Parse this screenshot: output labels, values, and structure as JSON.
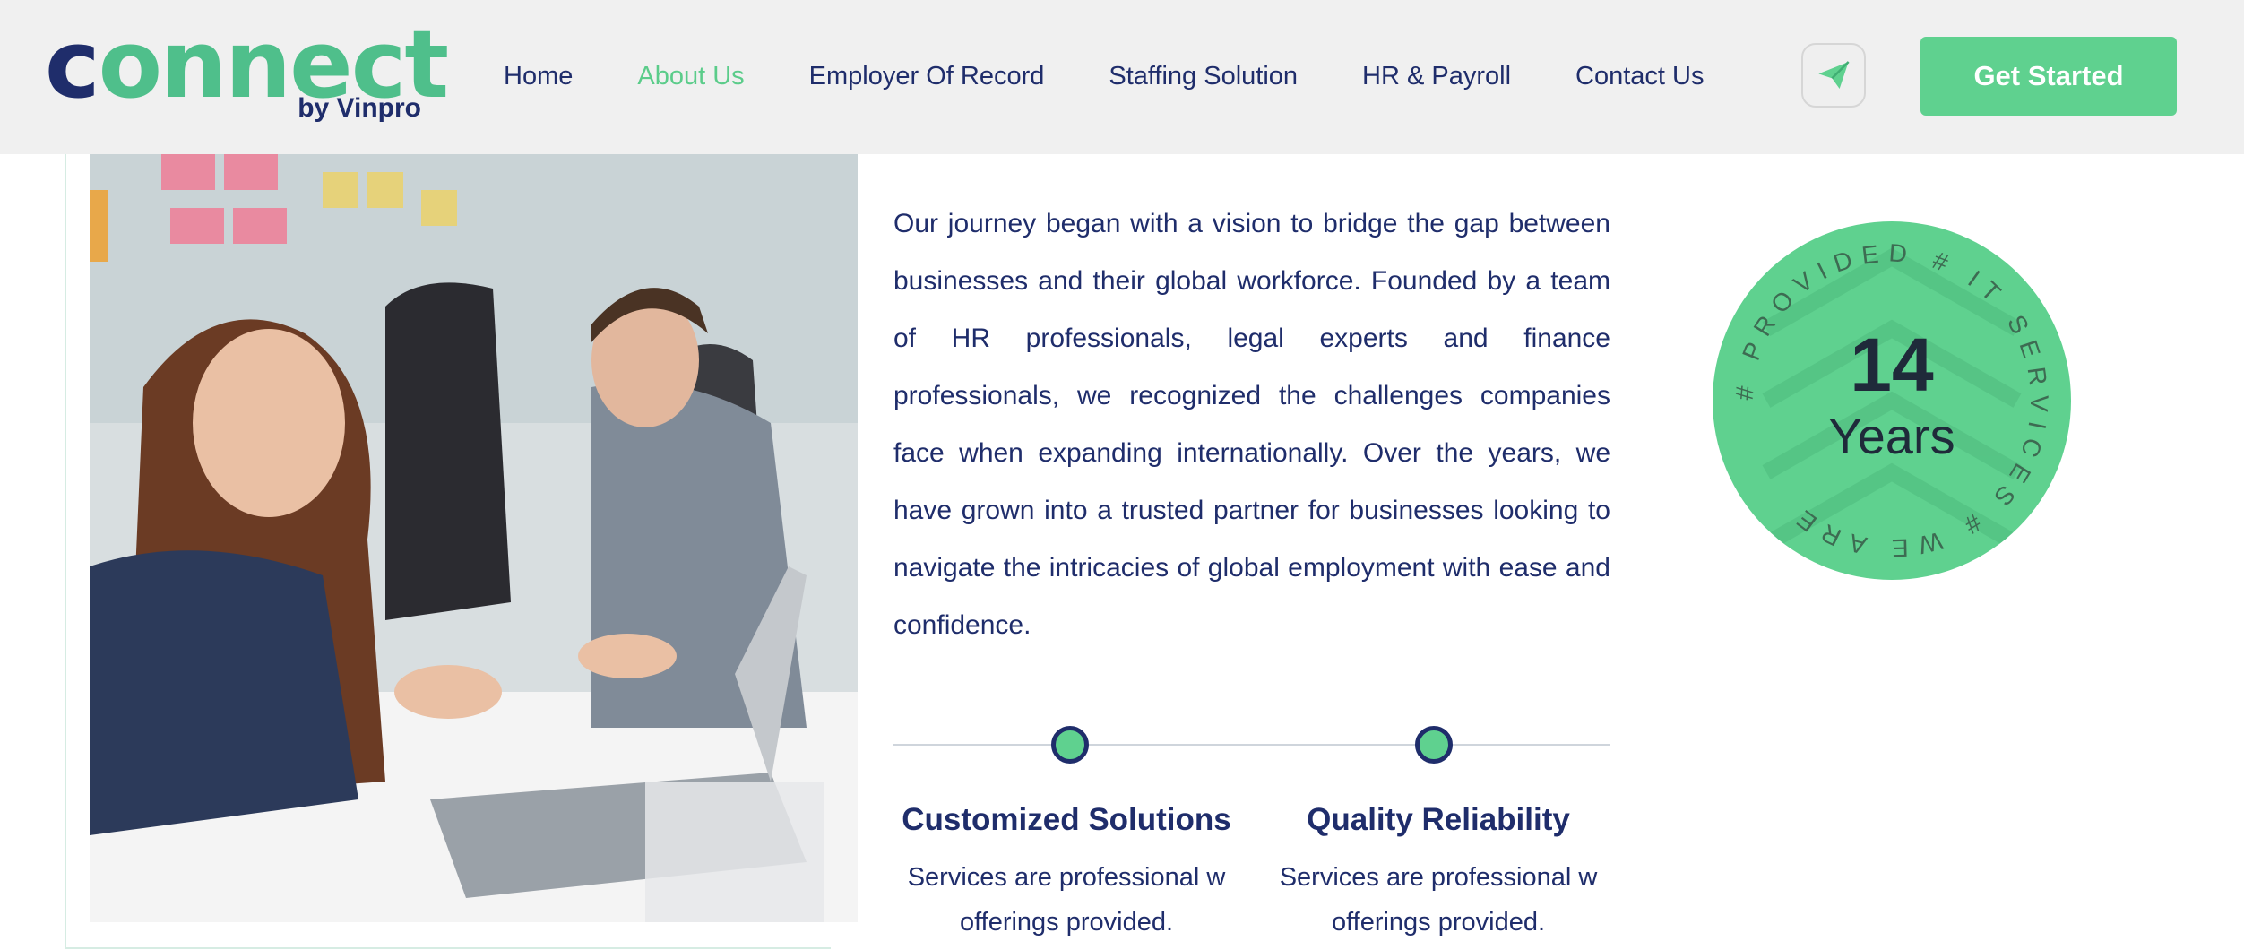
{
  "brand": {
    "logo_word": "onnect",
    "logo_c": "c",
    "logo_sub": "by Vinpro"
  },
  "nav": {
    "items": [
      {
        "label": "Home",
        "active": false
      },
      {
        "label": "About Us",
        "active": true
      },
      {
        "label": "Employer Of Record",
        "active": false
      },
      {
        "label": "Staffing Solution",
        "active": false
      },
      {
        "label": "HR & Payroll",
        "active": false
      },
      {
        "label": "Contact Us",
        "active": false
      }
    ],
    "send_icon": "paper-plane-icon",
    "cta_label": "Get Started"
  },
  "about": {
    "paragraph": "Our journey began with a vision to bridge the gap between businesses and their global workforce. Founded by a team of HR professionals, legal experts and finance professionals, we recognized the challenges companies face when expanding internationally. Over the years, we have grown into a trusted partner for businesses looking to navigate the intricacies of global employment with ease and confidence."
  },
  "features": [
    {
      "title": "Customized Solutions",
      "desc_line1": "Services are professional w",
      "desc_line2": "offerings provided."
    },
    {
      "title": "Quality Reliability",
      "desc_line1": "Services are professional w",
      "desc_line2": "offerings provided."
    }
  ],
  "badge": {
    "number": "14",
    "label": "Years",
    "ring_text": "# PROVIDED # IT SERVICES # WE ARE"
  },
  "colors": {
    "accent": "#5fd18f",
    "navy": "#1f2d6b",
    "header_bg": "#f0f0f0"
  }
}
